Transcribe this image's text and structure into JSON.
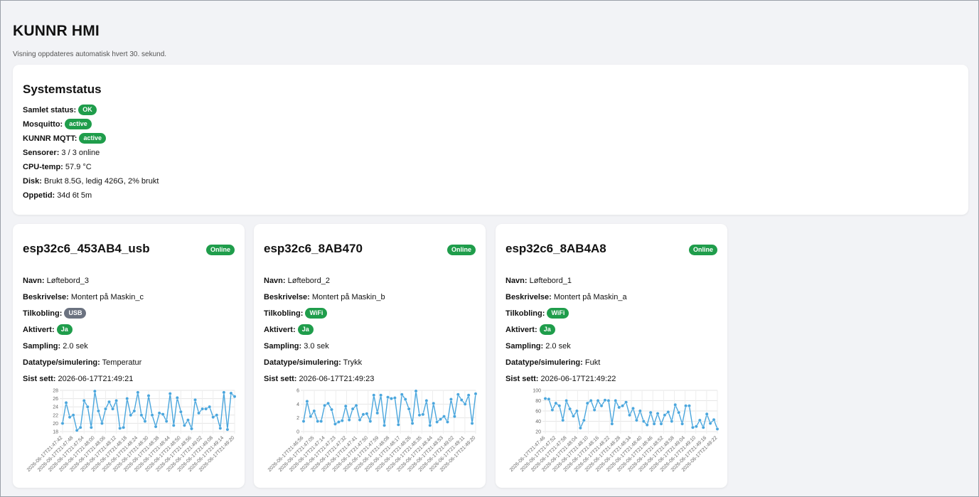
{
  "header": {
    "title": "KUNNR HMI",
    "subtitle": "Visning oppdateres automatisk hvert 30. sekund."
  },
  "system": {
    "title": "Systemstatus",
    "rows": [
      {
        "label": "Samlet status:",
        "badge": "OK"
      },
      {
        "label": "Mosquitto:",
        "badge": "active"
      },
      {
        "label": "KUNNR MQTT:",
        "badge": "active"
      },
      {
        "label": "Sensorer:",
        "value": "3 / 3 online"
      },
      {
        "label": "CPU-temp:",
        "value": "57.9 °C"
      },
      {
        "label": "Disk:",
        "value": "Brukt 8.5G, ledig 426G, 2% brukt"
      },
      {
        "label": "Oppetid:",
        "value": "34d 6t 5m"
      }
    ]
  },
  "labels": {
    "navn": "Navn:",
    "beskrivelse": "Beskrivelse:",
    "tilkobling": "Tilkobling:",
    "aktivert": "Aktivert:",
    "sampling": "Sampling:",
    "datatype": "Datatype/simulering:",
    "sist_sett": "Sist sett:"
  },
  "colors": {
    "badge_green": "#1f9d4b",
    "badge_gray": "#6b7280",
    "line": "#4aa6dd"
  },
  "sensors": [
    {
      "id": "esp32c6_453AB4_usb",
      "status": "Online",
      "navn": "Løftebord_3",
      "beskrivelse": "Montert på Maskin_c",
      "tilkobling": "USB",
      "aktivert": "Ja",
      "sampling": "2.0 sek",
      "datatype": "Temperatur",
      "sist_sett": "2026-06-17T21:49:21"
    },
    {
      "id": "esp32c6_8AB470",
      "status": "Online",
      "navn": "Løftebord_2",
      "beskrivelse": "Montert på Maskin_b",
      "tilkobling": "WiFi",
      "aktivert": "Ja",
      "sampling": "3.0 sek",
      "datatype": "Trykk",
      "sist_sett": "2026-06-17T21:49:23"
    },
    {
      "id": "esp32c6_8AB4A8",
      "status": "Online",
      "navn": "Løftebord_1",
      "beskrivelse": "Montert på Maskin_a",
      "tilkobling": "WiFi",
      "aktivert": "Ja",
      "sampling": "2.0 sek",
      "datatype": "Fukt",
      "sist_sett": "2026-06-17T21:49:22"
    }
  ],
  "chart_data": [
    {
      "type": "line",
      "ylim": [
        18,
        28
      ],
      "yticks": [
        18,
        20,
        22,
        24,
        26,
        28
      ],
      "xticks": [
        "2026-06-17T21:47:42",
        "2026-06-17T21:47:48",
        "2026-06-17T21:47:54",
        "2026-06-17T21:48:00",
        "2026-06-17T21:48:06",
        "2026-06-17T21:48:12",
        "2026-06-17T21:48:18",
        "2026-06-17T21:48:24",
        "2026-06-17T21:48:30",
        "2026-06-17T21:48:38",
        "2026-06-17T21:48:44",
        "2026-06-17T21:48:50",
        "2026-06-17T21:48:56",
        "2026-06-17T21:49:02",
        "2026-06-17T21:49:08",
        "2026-06-17T21:49:14",
        "2026-06-17T21:49:20"
      ],
      "values": [
        20,
        25,
        21.5,
        22,
        18.3,
        19,
        25.5,
        24,
        19,
        27.8,
        23,
        20,
        23.5,
        25.2,
        23.5,
        25.5,
        18.8,
        19,
        26,
        22,
        23,
        27.5,
        22,
        20.5,
        26.7,
        22,
        19.2,
        22.5,
        22.2,
        20.5,
        27.2,
        19.5,
        26.2,
        22.8,
        19.5,
        20.8,
        18.7,
        25.7,
        22.5,
        23.5,
        23.5,
        24,
        21.5,
        22,
        18.8,
        27.5,
        18.5,
        27.3,
        26.5
      ]
    },
    {
      "type": "line",
      "ylim": [
        0,
        6
      ],
      "yticks": [
        0,
        2,
        4,
        6
      ],
      "xticks": [
        "2026-06-17T21:46:56",
        "2026-06-17T21:47:05",
        "2026-06-17T21:47:14",
        "2026-06-17T21:47:23",
        "2026-06-17T21:47:32",
        "2026-06-17T21:47:41",
        "2026-06-17T21:47:50",
        "2026-06-17T21:47:59",
        "2026-06-17T21:48:08",
        "2026-06-17T21:48:17",
        "2026-06-17T21:48:26",
        "2026-06-17T21:48:35",
        "2026-06-17T21:48:44",
        "2026-06-17T21:48:53",
        "2026-06-17T21:49:02",
        "2026-06-17T21:49:11",
        "2026-06-17T21:49:20"
      ],
      "values": [
        1.5,
        4.4,
        2.2,
        3,
        1.5,
        1.5,
        3.8,
        4.1,
        3.2,
        1.1,
        1.4,
        1.6,
        3.7,
        1.7,
        3.3,
        3.8,
        1.7,
        2.5,
        2.6,
        1.5,
        5.3,
        2.7,
        5.3,
        0.9,
        5,
        4.8,
        4.9,
        1,
        5.4,
        4.7,
        3.3,
        1.2,
        5.9,
        2.4,
        2.5,
        4.5,
        0.9,
        4.1,
        1.4,
        1.8,
        2.2,
        1.4,
        4.7,
        2.2,
        5.4,
        4.6,
        4,
        5.3,
        1.2,
        5.5
      ]
    },
    {
      "type": "line",
      "ylim": [
        20,
        100
      ],
      "yticks": [
        20,
        40,
        60,
        80,
        100
      ],
      "xticks": [
        "2026-06-17T21:47:46",
        "2026-06-17T21:47:52",
        "2026-06-17T21:47:58",
        "2026-06-17T21:48:04",
        "2026-06-17T21:48:10",
        "2026-06-17T21:48:16",
        "2026-06-17T21:48:22",
        "2026-06-17T21:48:28",
        "2026-06-17T21:48:34",
        "2026-06-17T21:48:40",
        "2026-06-17T21:48:46",
        "2026-06-17T21:48:52",
        "2026-06-17T21:48:58",
        "2026-06-17T21:49:04",
        "2026-06-17T21:49:10",
        "2026-06-17T21:49:16",
        "2026-06-17T21:49:22"
      ],
      "values": [
        84,
        83,
        62,
        75,
        70,
        42,
        80,
        64,
        50,
        60,
        27,
        42,
        75,
        80,
        62,
        80,
        70,
        81,
        80,
        35,
        80,
        67,
        70,
        77,
        52,
        65,
        42,
        60,
        40,
        33,
        57,
        35,
        55,
        35,
        52,
        58,
        40,
        72,
        57,
        35,
        70,
        70,
        28,
        30,
        42,
        28,
        54,
        36,
        43,
        25
      ]
    }
  ]
}
